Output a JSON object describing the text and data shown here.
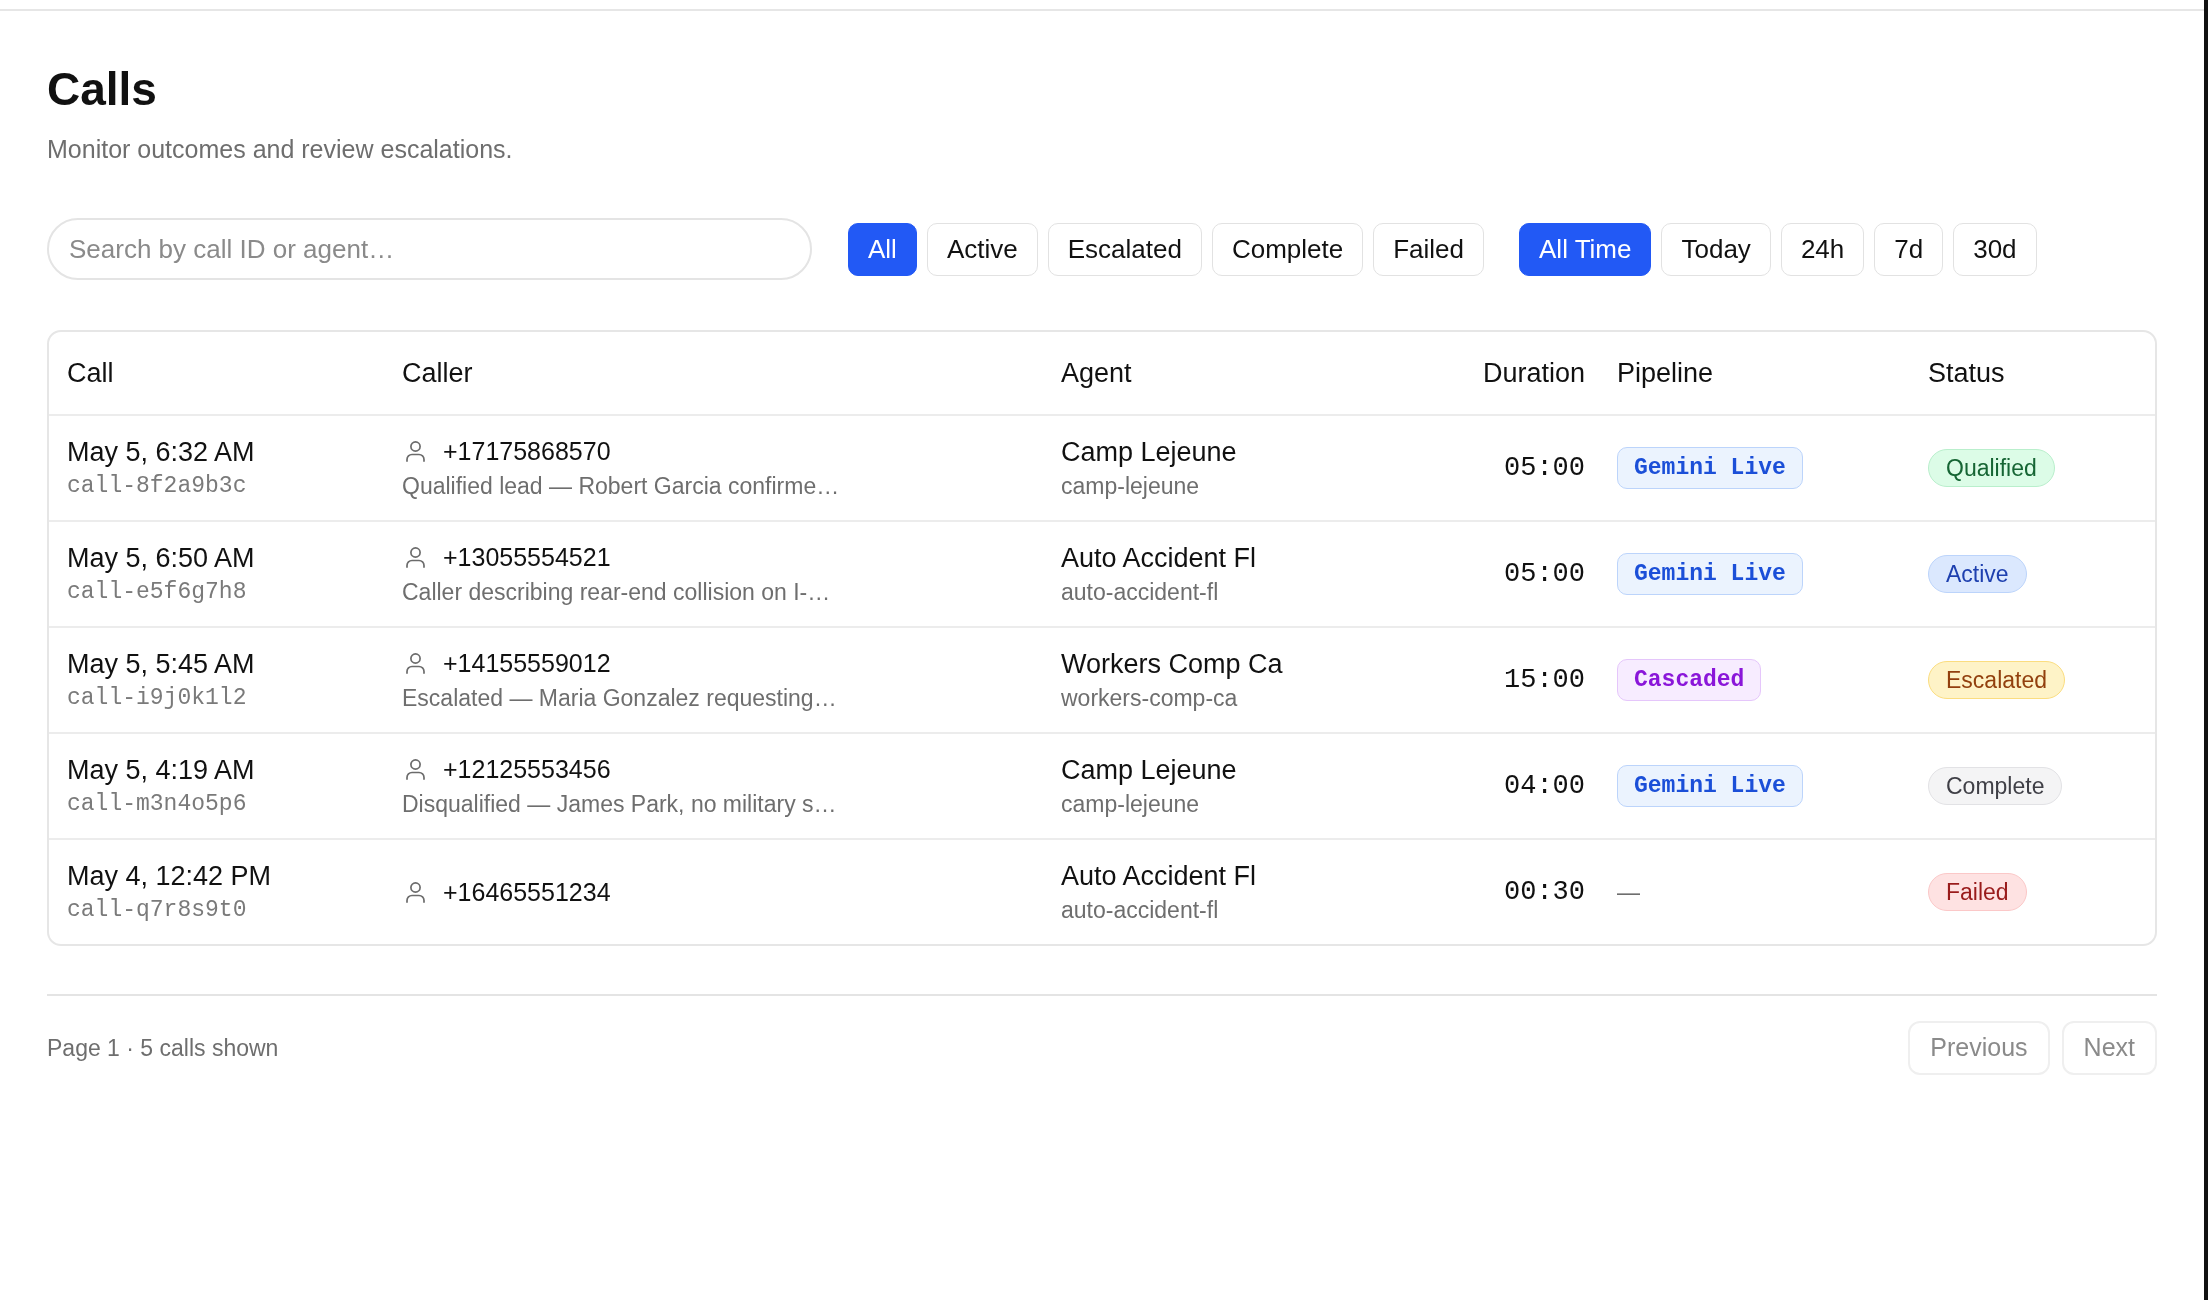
{
  "page": {
    "title": "Calls",
    "subtitle": "Monitor outcomes and review escalations."
  },
  "search": {
    "placeholder": "Search by call ID or agent…"
  },
  "status_filters": [
    {
      "label": "All",
      "selected": true
    },
    {
      "label": "Active",
      "selected": false
    },
    {
      "label": "Escalated",
      "selected": false
    },
    {
      "label": "Complete",
      "selected": false
    },
    {
      "label": "Failed",
      "selected": false
    }
  ],
  "time_filters": [
    {
      "label": "All Time",
      "selected": true
    },
    {
      "label": "Today",
      "selected": false
    },
    {
      "label": "24h",
      "selected": false
    },
    {
      "label": "7d",
      "selected": false
    },
    {
      "label": "30d",
      "selected": false
    }
  ],
  "table": {
    "columns": [
      "Call",
      "Caller",
      "Agent",
      "Duration",
      "Pipeline",
      "Status"
    ],
    "rows": [
      {
        "time": "May 5, 6:32 AM",
        "call_id": "call-8f2a9b3c",
        "phone": "+17175868570",
        "summary": "Qualified lead — Robert Garcia confirme…",
        "agent_name": "Camp Lejeune",
        "agent_slug": "camp-lejeune",
        "duration": "05:00",
        "pipeline": {
          "kind": "gemini",
          "label": "Gemini Live"
        },
        "status": {
          "kind": "qualified",
          "label": "Qualified"
        }
      },
      {
        "time": "May 5, 6:50 AM",
        "call_id": "call-e5f6g7h8",
        "phone": "+13055554521",
        "summary": "Caller describing rear-end collision on I-…",
        "agent_name": "Auto Accident Fl",
        "agent_slug": "auto-accident-fl",
        "duration": "05:00",
        "pipeline": {
          "kind": "gemini",
          "label": "Gemini Live"
        },
        "status": {
          "kind": "active",
          "label": "Active"
        }
      },
      {
        "time": "May 5, 5:45 AM",
        "call_id": "call-i9j0k1l2",
        "phone": "+14155559012",
        "summary": "Escalated — Maria Gonzalez requesting…",
        "agent_name": "Workers Comp Ca",
        "agent_slug": "workers-comp-ca",
        "duration": "15:00",
        "pipeline": {
          "kind": "cascaded",
          "label": "Cascaded"
        },
        "status": {
          "kind": "escalated",
          "label": "Escalated"
        }
      },
      {
        "time": "May 5, 4:19 AM",
        "call_id": "call-m3n4o5p6",
        "phone": "+12125553456",
        "summary": "Disqualified — James Park, no military s…",
        "agent_name": "Camp Lejeune",
        "agent_slug": "camp-lejeune",
        "duration": "04:00",
        "pipeline": {
          "kind": "gemini",
          "label": "Gemini Live"
        },
        "status": {
          "kind": "complete",
          "label": "Complete"
        }
      },
      {
        "time": "May 4, 12:42 PM",
        "call_id": "call-q7r8s9t0",
        "phone": "+16465551234",
        "agent_name": "Auto Accident Fl",
        "agent_slug": "auto-accident-fl",
        "duration": "00:30",
        "pipeline": {
          "kind": "none",
          "label": "—"
        },
        "status": {
          "kind": "failed",
          "label": "Failed"
        }
      }
    ]
  },
  "footer": {
    "summary": "Page 1 · 5 calls shown",
    "buttons": [
      {
        "label": "Previous",
        "disabled": true
      },
      {
        "label": "Next",
        "disabled": true
      }
    ]
  }
}
